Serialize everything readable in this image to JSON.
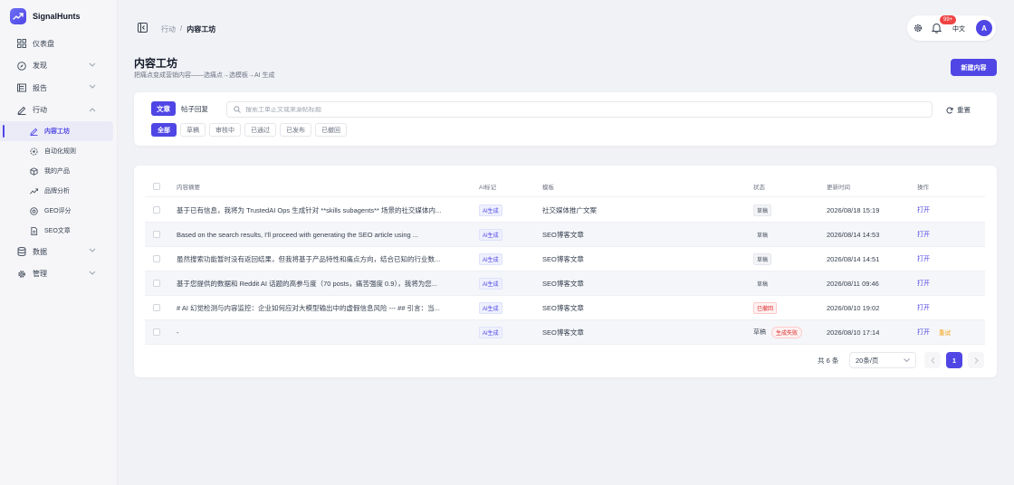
{
  "app": {
    "name": "SignalHunts"
  },
  "sidebar": {
    "items": [
      {
        "label": "仪表盘",
        "icon": "dashboard-icon"
      },
      {
        "label": "发现",
        "icon": "compass-icon",
        "expandable": true
      },
      {
        "label": "报告",
        "icon": "report-icon",
        "expandable": true
      },
      {
        "label": "行动",
        "icon": "pen-icon",
        "expandable": true,
        "expanded": true,
        "children": [
          {
            "label": "内容工坊",
            "icon": "pen-icon",
            "active": true
          },
          {
            "label": "自动化规则",
            "icon": "automation-icon"
          },
          {
            "label": "我的产品",
            "icon": "box-icon"
          },
          {
            "label": "品牌分析",
            "icon": "trend-icon"
          },
          {
            "label": "GEO评分",
            "icon": "target-icon"
          },
          {
            "label": "SEO文章",
            "icon": "document-icon"
          }
        ]
      },
      {
        "label": "数据",
        "icon": "database-icon",
        "expandable": true
      },
      {
        "label": "管理",
        "icon": "gear-icon",
        "expandable": true
      }
    ]
  },
  "header": {
    "breadcrumb": [
      "行动",
      "内容工坊"
    ],
    "breadcrumb_sep": "/",
    "notification_badge": "99+",
    "language": "中文",
    "avatar_initial": "A"
  },
  "page": {
    "title": "内容工坊",
    "subtitle": "把痛点变成营销内容——选痛点→选模板→AI 生成",
    "new_button": "新建内容"
  },
  "filters": {
    "source_tabs": [
      {
        "label": "文章",
        "active": true
      },
      {
        "label": "帖子回复",
        "active": false
      }
    ],
    "search_placeholder": "搜索工单正文或来源帖标题",
    "reset_label": "重置",
    "status_chips": [
      {
        "label": "全部",
        "active": true
      },
      {
        "label": "草稿",
        "active": false
      },
      {
        "label": "审核中",
        "active": false
      },
      {
        "label": "已通过",
        "active": false
      },
      {
        "label": "已发布",
        "active": false
      },
      {
        "label": "已撤回",
        "active": false
      }
    ]
  },
  "table": {
    "columns": [
      "内容摘要",
      "AI标记",
      "模板",
      "状态",
      "更新时间",
      "操作"
    ],
    "rows": [
      {
        "summary": "基于已有信息，我将为 TrustedAI Ops 生成针对 **skills subagents** 场景的社交媒体内...",
        "ai_tag": "AI生成",
        "template": "社交媒体推广文案",
        "status": "草稿",
        "status_style": "tag",
        "failed_tag": "",
        "updated": "2026/08/18 15:19",
        "action": "打开",
        "retry": ""
      },
      {
        "summary": "Based on the search results, I'll proceed with generating the SEO article using ...",
        "ai_tag": "AI生成",
        "template": "SEO博客文章",
        "status": "草稿",
        "status_style": "tag",
        "failed_tag": "",
        "updated": "2026/08/14 14:53",
        "action": "打开",
        "retry": ""
      },
      {
        "summary": "虽然搜索功能暂时没有返回结果，但我将基于产品特性和痛点方向，结合已知的行业数...",
        "ai_tag": "AI生成",
        "template": "SEO博客文章",
        "status": "草稿",
        "status_style": "tag",
        "failed_tag": "",
        "updated": "2026/08/14 14:51",
        "action": "打开",
        "retry": ""
      },
      {
        "summary": "基于您提供的数据和 Reddit AI 话题的高参与度（70 posts，痛苦强度 0.9），我将为您...",
        "ai_tag": "AI生成",
        "template": "SEO博客文章",
        "status": "草稿",
        "status_style": "tag",
        "failed_tag": "",
        "updated": "2026/08/11 09:46",
        "action": "打开",
        "retry": ""
      },
      {
        "summary": "# AI 幻觉检测与内容监控：企业如何应对大模型输出中的虚假信息风险 --- ## 引言：当...",
        "ai_tag": "AI生成",
        "template": "SEO博客文章",
        "status": "已撤回",
        "status_style": "red",
        "failed_tag": "",
        "updated": "2026/08/10 19:02",
        "action": "打开",
        "retry": ""
      },
      {
        "summary": "-",
        "ai_tag": "AI生成",
        "template": "SEO博客文章",
        "status": "草稿",
        "status_style": "plain",
        "failed_tag": "生成失败",
        "updated": "2026/08/10 17:14",
        "action": "打开",
        "retry": "重试"
      }
    ]
  },
  "pagination": {
    "total": "共 6 条",
    "page_size": "20条/页",
    "current_page": "1"
  },
  "colors": {
    "accent": "#4f46e5",
    "danger": "#dc2626",
    "warning": "#f59e0b"
  }
}
